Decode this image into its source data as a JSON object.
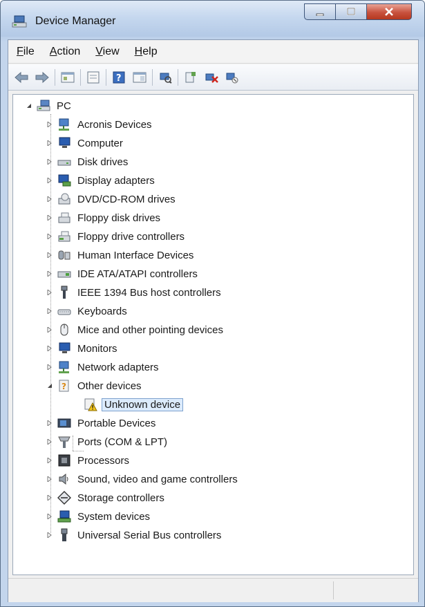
{
  "window": {
    "title": "Device Manager",
    "buttons": {
      "minimize": "minimize-icon",
      "maximize": "maximize-icon",
      "close": "close-icon"
    }
  },
  "menubar": [
    {
      "label": "File",
      "accel": "F",
      "rest": "ile"
    },
    {
      "label": "Action",
      "accel": "A",
      "rest": "ction"
    },
    {
      "label": "View",
      "accel": "V",
      "rest": "iew"
    },
    {
      "label": "Help",
      "accel": "H",
      "rest": "elp"
    }
  ],
  "toolbar": [
    "back-icon",
    "forward-icon",
    "properties-grid-icon",
    "properties-icon",
    "help-icon",
    "details-grid-icon",
    "scan-hardware-icon",
    "update-driver-icon",
    "uninstall-icon",
    "disable-icon"
  ],
  "tree": {
    "root": "PC",
    "categories": [
      {
        "label": "Acronis Devices",
        "icon": "network-icon"
      },
      {
        "label": "Computer",
        "icon": "monitor-icon"
      },
      {
        "label": "Disk drives",
        "icon": "disk-drive-icon"
      },
      {
        "label": "Display adapters",
        "icon": "display-adapter-icon"
      },
      {
        "label": "DVD/CD-ROM drives",
        "icon": "dvd-drive-icon"
      },
      {
        "label": "Floppy disk drives",
        "icon": "floppy-drive-icon"
      },
      {
        "label": "Floppy drive controllers",
        "icon": "floppy-controller-icon"
      },
      {
        "label": "Human Interface Devices",
        "icon": "hid-icon"
      },
      {
        "label": "IDE ATA/ATAPI controllers",
        "icon": "ide-controller-icon"
      },
      {
        "label": "IEEE 1394 Bus host controllers",
        "icon": "firewire-icon"
      },
      {
        "label": "Keyboards",
        "icon": "keyboard-icon"
      },
      {
        "label": "Mice and other pointing devices",
        "icon": "mouse-icon"
      },
      {
        "label": "Monitors",
        "icon": "monitor-icon"
      },
      {
        "label": "Network adapters",
        "icon": "network-icon"
      },
      {
        "label": "Other devices",
        "icon": "other-devices-icon",
        "expanded": true,
        "children": [
          {
            "label": "Unknown device",
            "icon": "unknown-device-warning-icon",
            "selected": true
          }
        ]
      },
      {
        "label": "Portable Devices",
        "icon": "portable-device-icon"
      },
      {
        "label": "Ports (COM & LPT)",
        "icon": "port-icon"
      },
      {
        "label": "Processors",
        "icon": "processor-icon"
      },
      {
        "label": "Sound, video and game controllers",
        "icon": "speaker-icon"
      },
      {
        "label": "Storage controllers",
        "icon": "storage-controller-icon"
      },
      {
        "label": "System devices",
        "icon": "system-device-icon"
      },
      {
        "label": "Universal Serial Bus controllers",
        "icon": "usb-icon"
      }
    ]
  }
}
